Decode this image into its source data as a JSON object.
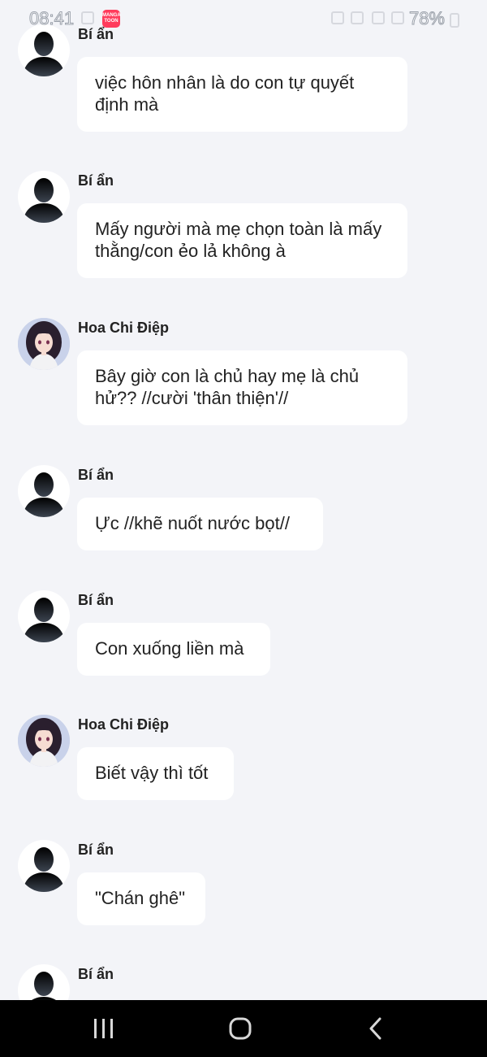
{
  "status_bar": {
    "time": "08:41",
    "app_icon_text": "MANGA TOON",
    "battery": "78%"
  },
  "messages": [
    {
      "sender": "Bí ẩn",
      "avatar": "silhouette-avatar",
      "text": "việc hôn nhân là do con tự quyết định mà"
    },
    {
      "sender": "Bí ẩn",
      "avatar": "silhouette-avatar",
      "text": "Mấy người mà mẹ chọn toàn là mấy thằng/con ẻo lả không à"
    },
    {
      "sender": "Hoa Chi Điệp",
      "avatar": "anime-girl-avatar",
      "text": "Bây giờ con là chủ hay mẹ là chủ hử?? //cười 'thân thiện'//"
    },
    {
      "sender": "Bí ẩn",
      "avatar": "silhouette-avatar",
      "text": "Ực //khẽ nuốt nước bọt//"
    },
    {
      "sender": "Bí ẩn",
      "avatar": "silhouette-avatar",
      "text": "Con xuống liền mà"
    },
    {
      "sender": "Hoa Chi Điệp",
      "avatar": "anime-girl-avatar",
      "text": "Biết vậy thì tốt"
    },
    {
      "sender": "Bí ẩn",
      "avatar": "silhouette-avatar",
      "text": "\"Chán ghê\""
    },
    {
      "sender": "Bí ẩn",
      "avatar": "silhouette-avatar",
      "text": ""
    }
  ],
  "nav_bar": {
    "recent_icon": "recent-apps-icon",
    "home_icon": "home-icon",
    "back_icon": "back-icon"
  }
}
